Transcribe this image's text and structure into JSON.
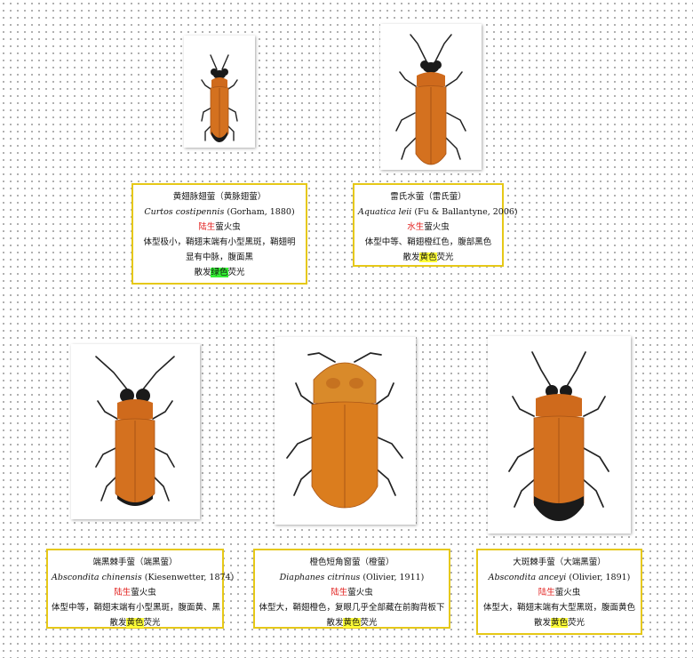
{
  "specimens": [
    {
      "common": "黄翅脉翅萤（黄脉翅萤）",
      "sci_name": "Curtos costipennis",
      "author": "(Gorham, 1880)",
      "habitat_word": "陆生",
      "habitat_suffix": "萤火虫",
      "desc": [
        "体型极小，鞘翅末端有小型黑斑，鞘翅明",
        "显有中脉，腹面黑"
      ],
      "light_prefix": "散发",
      "light_color": "绿色",
      "light_suffix": "荧光",
      "light_highlight": "#35ef35"
    },
    {
      "common": "雷氏水萤（雷氏萤）",
      "sci_name": "Aquatica leii",
      "author": "(Fu & Ballantyne, 2006)",
      "habitat_word": "水生",
      "habitat_suffix": "萤火虫",
      "desc": [
        "体型中等、鞘翅橙红色，腹部黑色"
      ],
      "light_prefix": "散发",
      "light_color": "黄色",
      "light_suffix": "荧光",
      "light_highlight": "#ffff38"
    },
    {
      "common": "端黑棘手萤（端黑萤）",
      "sci_name": "Abscondita chinensis",
      "author": "(Kiesenwetter, 1874)",
      "habitat_word": "陆生",
      "habitat_suffix": "萤火虫",
      "desc": [
        "体型中等，鞘翅末端有小型黑斑，腹面黄、黑"
      ],
      "light_prefix": "散发",
      "light_color": "黄色",
      "light_suffix": "荧光",
      "light_highlight": "#ffff38"
    },
    {
      "common": "橙色短角窗萤（橙萤）",
      "sci_name": "Diaphanes citrinus",
      "author": "(Olivier, 1911)",
      "habitat_word": "陆生",
      "habitat_suffix": "萤火虫",
      "desc": [
        "体型大，鞘翅橙色，复眼几乎全部藏在前胸背板下"
      ],
      "light_prefix": "散发",
      "light_color": "黄色",
      "light_suffix": "荧光",
      "light_highlight": "#ffff38"
    },
    {
      "common": "大斑棘手萤（大端黑萤）",
      "sci_name": "Abscondita anceyi",
      "author": "(Olivier, 1891)",
      "habitat_word": "陆生",
      "habitat_suffix": "萤火虫",
      "desc": [
        "体型大，鞘翅末端有大型黑斑，腹面黄色"
      ],
      "light_prefix": "散发",
      "light_color": "黄色",
      "light_suffix": "荧光",
      "light_highlight": "#ffff38"
    }
  ],
  "colors": {
    "card_border": "#e6c817",
    "habitat_red": "#e2211f",
    "beetle_orange": "#d4711f",
    "beetle_black": "#1a1a1a"
  }
}
